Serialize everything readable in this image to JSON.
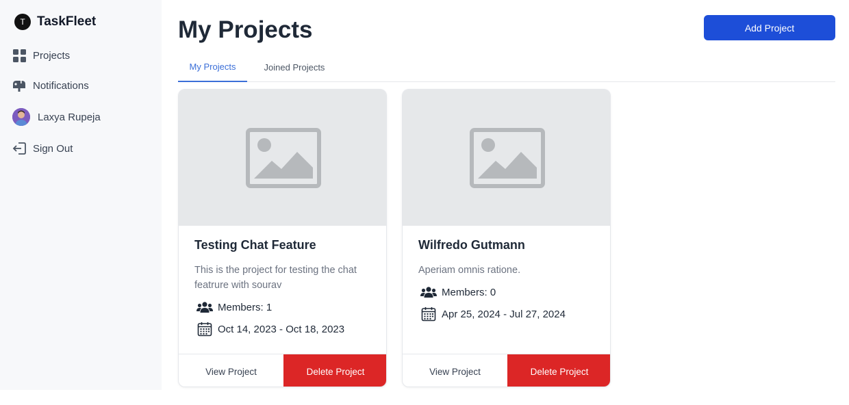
{
  "app": {
    "logo_letter": "T",
    "name": "TaskFleet"
  },
  "sidebar": {
    "items": [
      {
        "label": "Projects",
        "icon": "grid-icon"
      },
      {
        "label": "Notifications",
        "icon": "mailbox-icon"
      },
      {
        "label": "Laxya Rupeja",
        "icon": "avatar"
      },
      {
        "label": "Sign Out",
        "icon": "sign-out-icon"
      }
    ]
  },
  "header": {
    "title": "My Projects",
    "add_label": "Add Project"
  },
  "tabs": [
    {
      "label": "My Projects",
      "active": true
    },
    {
      "label": "Joined Projects",
      "active": false
    }
  ],
  "projects": [
    {
      "title": "Testing Chat Feature",
      "description": "This is the project for testing the chat featrure with sourav",
      "members": "Members: 1",
      "dates": "Oct 14, 2023 - Oct 18, 2023",
      "view_label": "View Project",
      "delete_label": "Delete Project"
    },
    {
      "title": "Wilfredo Gutmann",
      "description": "Aperiam omnis ratione.",
      "members": "Members: 0",
      "dates": "Apr 25, 2024 - Jul 27, 2024",
      "view_label": "View Project",
      "delete_label": "Delete Project"
    }
  ],
  "colors": {
    "primary": "#1d4ed8",
    "danger": "#dc2626",
    "tab_active": "#3b6fd8",
    "sidebar_bg": "#f7f8fa"
  }
}
